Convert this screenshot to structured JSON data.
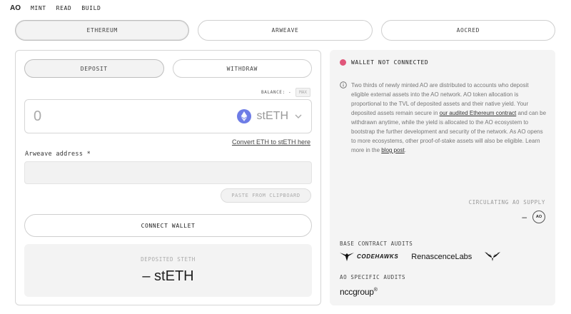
{
  "nav": {
    "logo": "AO",
    "links": [
      "MINT",
      "READ",
      "BUILD"
    ]
  },
  "chain_tabs": [
    {
      "label": "ETHEREUM",
      "active": true
    },
    {
      "label": "ARWEAVE",
      "active": false
    },
    {
      "label": "AOCRED",
      "active": false
    }
  ],
  "mode_tabs": [
    {
      "label": "DEPOSIT",
      "active": true
    },
    {
      "label": "WITHDRAW",
      "active": false
    }
  ],
  "balance": {
    "label": "BALANCE: -",
    "max_label": "MAX"
  },
  "amount": {
    "placeholder": "0",
    "token": "stETH",
    "token_icon": "ethereum-icon"
  },
  "convert_link": "Convert ETH to stETH here",
  "address": {
    "label": "Arweave address *",
    "placeholder": "",
    "paste_label": "PASTE FROM CLIPBOARD"
  },
  "connect_label": "CONNECT WALLET",
  "deposited": {
    "label": "DEPOSITED STETH",
    "value": "– stETH"
  },
  "wallet": {
    "status": "WALLET NOT CONNECTED",
    "status_color": "#e0567a"
  },
  "info": {
    "part1": "Two thirds of newly minted AO are distributed to accounts who deposit eligible external assets into the AO network. AO token allocation is proportional to the TVL of deposited assets and their native yield. Your deposited assets remain secure in ",
    "link1": "our audited Ethereum contract",
    "part2": " and can be withdrawn anytime, while the yield is allocated to the AO ecosystem to bootstrap the further development and security of the network. As AO opens to more ecosystems, other proof-of-stake assets will also be eligible. Learn more in the ",
    "link2": "blog post",
    "part3": "."
  },
  "supply": {
    "label": "CIRCULATING AO SUPPLY",
    "value": "–",
    "badge": "AO"
  },
  "audits": {
    "base_label": "BASE CONTRACT AUDITS",
    "codehawks": "CODEHAWKS",
    "renascence": "RenascenceLabs",
    "ao_label": "AO SPECIFIC AUDITS",
    "ncc": "nccgroup",
    "ncc_mark": "®"
  }
}
